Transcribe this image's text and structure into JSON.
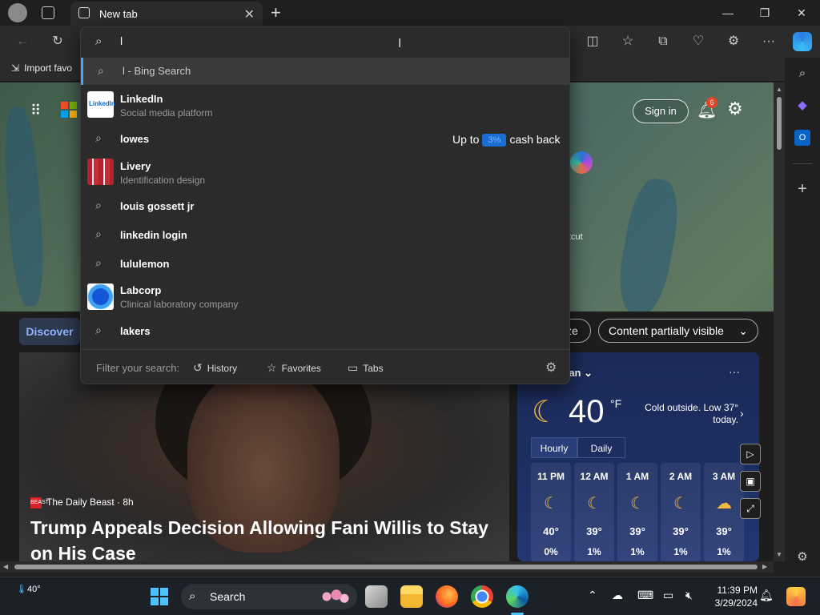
{
  "browser": {
    "tab_title": "New tab",
    "tab_close": "✕",
    "new_tab": "+",
    "favbar_item": "Import favo"
  },
  "address": {
    "value": "l"
  },
  "suggestions": [
    {
      "kind": "bing",
      "text": "l - Bing Search"
    },
    {
      "kind": "entity",
      "title": "LinkedIn",
      "subtitle": "Social media platform"
    },
    {
      "kind": "search",
      "text": "lowes"
    },
    {
      "kind": "entity",
      "title": "Livery",
      "subtitle": "Identification design"
    },
    {
      "kind": "search",
      "text": "louis gossett jr"
    },
    {
      "kind": "search",
      "text": "linkedin login"
    },
    {
      "kind": "search",
      "text": "lululemon"
    },
    {
      "kind": "entity",
      "title": "Labcorp",
      "subtitle": "Clinical laboratory company"
    },
    {
      "kind": "search",
      "text": "lakers"
    }
  ],
  "cashback": {
    "prefix": "Up to",
    "pct": "3%",
    "suffix": "cash back"
  },
  "filter": {
    "label": "Filter your search:",
    "history": "History",
    "favorites": "Favorites",
    "tabs": "Tabs"
  },
  "ntp": {
    "signin": "Sign in",
    "notifications": "6",
    "shortcut_fragment": "tcut",
    "discover": "Discover",
    "chip_partial": "ze",
    "content_chip": "Content partially visible",
    "news_source": "The Daily Beast · 8h",
    "news_source_logo": "BEAST",
    "headline": "Trump Appeals Decision Allowing Fani Willis to Stay on His Case"
  },
  "weather": {
    "location": "tan",
    "temp": "40",
    "unit": "°F",
    "message": "Cold outside. Low 37° today.",
    "tab_hourly": "Hourly",
    "tab_daily": "Daily",
    "hours": [
      {
        "time": "11 PM",
        "temp": "40°",
        "precip": "0%"
      },
      {
        "time": "12 AM",
        "temp": "39°",
        "precip": "1%"
      },
      {
        "time": "1 AM",
        "temp": "39°",
        "precip": "1%"
      },
      {
        "time": "2 AM",
        "temp": "39°",
        "precip": "1%"
      },
      {
        "time": "3 AM",
        "temp": "39°",
        "precip": "1%"
      }
    ]
  },
  "taskbar": {
    "weather_temp": "40°",
    "search": "Search",
    "time": "11:39 PM",
    "date": "3/29/2024"
  },
  "colors": {
    "accent": "#4aa0ff",
    "discover_bg": "#2d3a4e",
    "weather_bg": "#1d2f63",
    "badge": "#e0442b"
  }
}
